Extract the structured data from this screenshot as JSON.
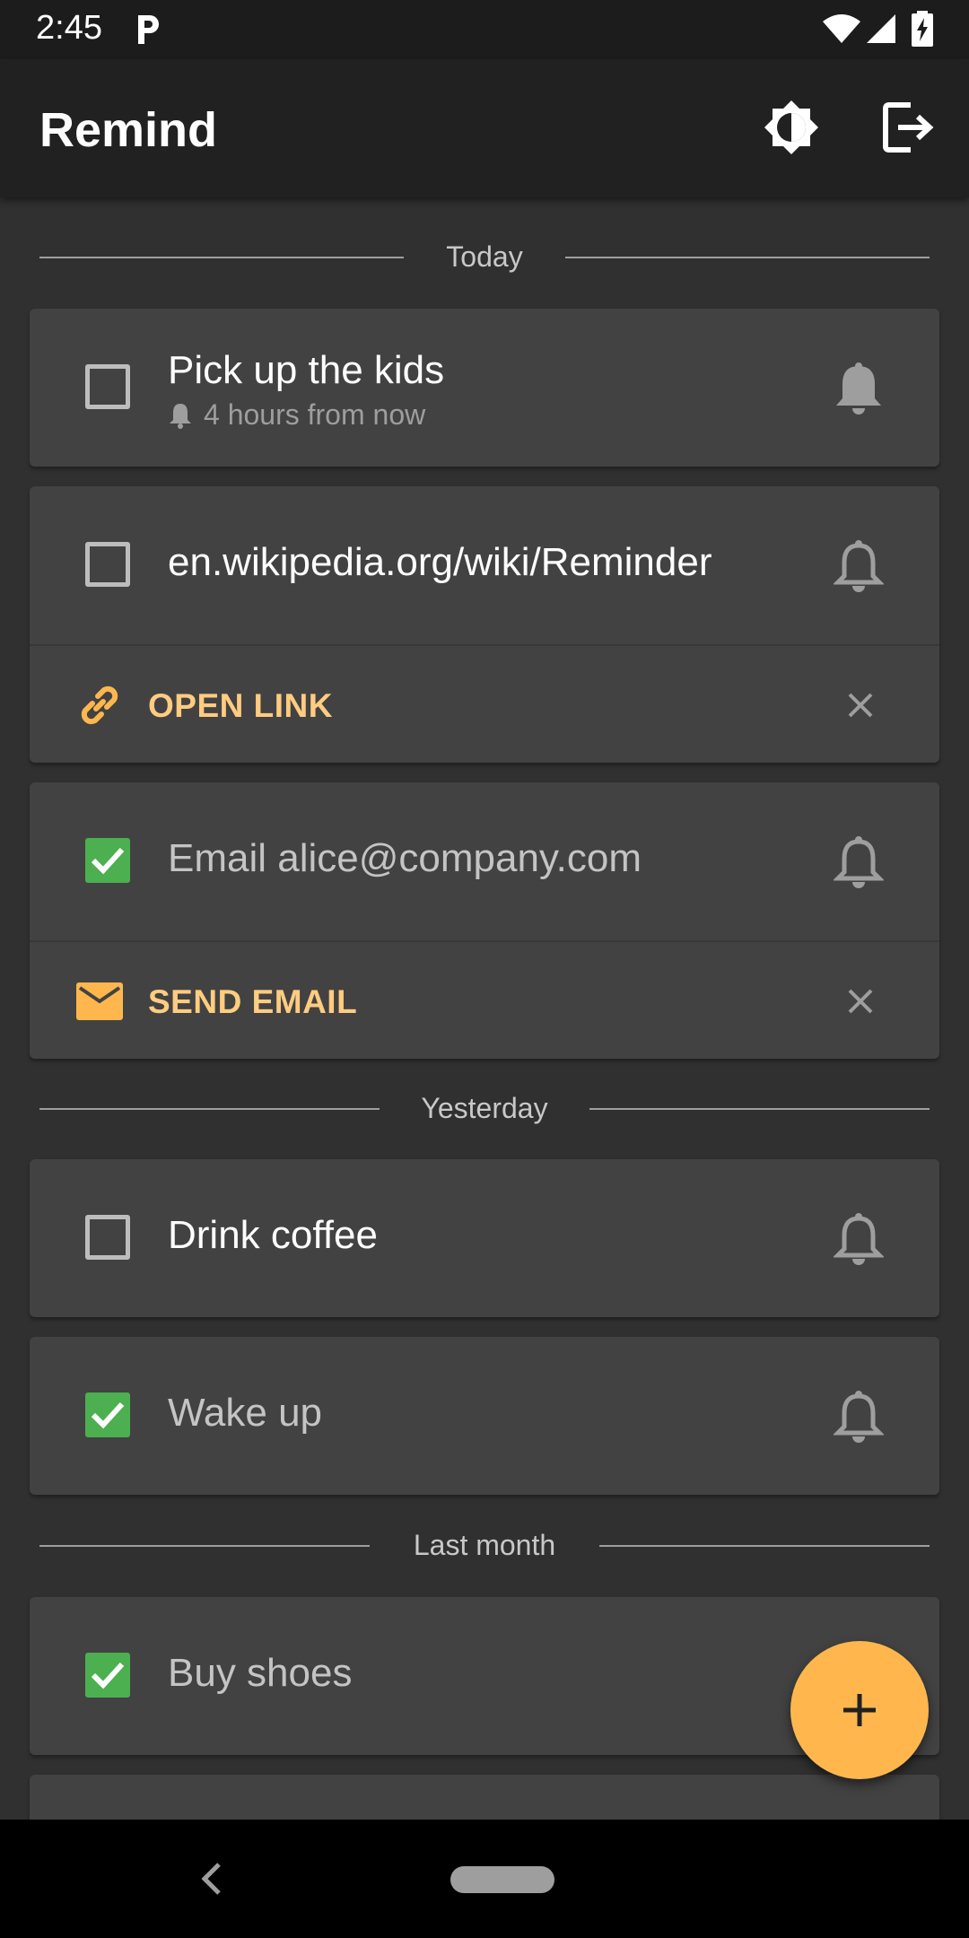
{
  "status_bar": {
    "time": "2:45",
    "icons": [
      "parking-icon",
      "wifi-icon",
      "signal-icon",
      "battery-charging-icon"
    ]
  },
  "app_bar": {
    "title": "Remind",
    "actions": [
      "brightness-icon",
      "logout-icon"
    ]
  },
  "sections": [
    {
      "label": "Today",
      "items": [
        {
          "title": "Pick up the kids",
          "subtitle": "4 hours from now",
          "checked": false,
          "reminder": "bell-filled-icon"
        },
        {
          "title": "en.wikipedia.org/wiki/Reminder",
          "checked": false,
          "reminder": "bell-outline-icon",
          "action": {
            "label": "OPEN LINK",
            "icon": "link-icon"
          }
        },
        {
          "title": "Email alice@company.com",
          "checked": true,
          "reminder": "bell-outline-icon",
          "action": {
            "label": "SEND EMAIL",
            "icon": "email-icon"
          }
        }
      ]
    },
    {
      "label": "Yesterday",
      "items": [
        {
          "title": "Drink coffee",
          "checked": false,
          "reminder": "bell-outline-icon"
        },
        {
          "title": "Wake up",
          "checked": true,
          "reminder": "bell-outline-icon"
        }
      ]
    },
    {
      "label": "Last month",
      "items": [
        {
          "title": "Buy shoes",
          "checked": true
        }
      ]
    }
  ],
  "fab": {
    "icon": "plus-icon"
  },
  "colors": {
    "background": "#303030",
    "card": "#424242",
    "app_bar": "#212121",
    "accent": "#ffb74d",
    "action_text": "#ffcc80",
    "checkbox_checked": "#4caf50"
  }
}
